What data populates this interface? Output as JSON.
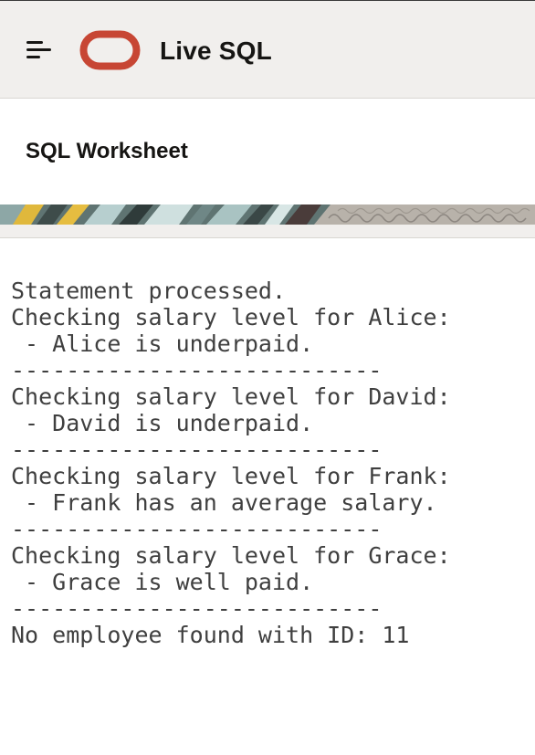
{
  "header": {
    "title": "Live SQL",
    "menu_icon": "hamburger-menu-icon",
    "logo": "oracle-logo-icon",
    "brand_color": "#c74634",
    "background": "#f1efed"
  },
  "worksheet": {
    "title": "SQL Worksheet"
  },
  "output": {
    "lines": [
      "Statement processed.",
      "Checking salary level for Alice:",
      " - Alice is underpaid.",
      "---------------------------",
      "Checking salary level for David:",
      " - David is underpaid.",
      "---------------------------",
      "Checking salary level for Frank:",
      " - Frank has an average salary.",
      "---------------------------",
      "Checking salary level for Grace:",
      " - Grace is well paid.",
      "---------------------------",
      "No employee found with ID: 11"
    ],
    "text_color": "#3f3f3f"
  }
}
